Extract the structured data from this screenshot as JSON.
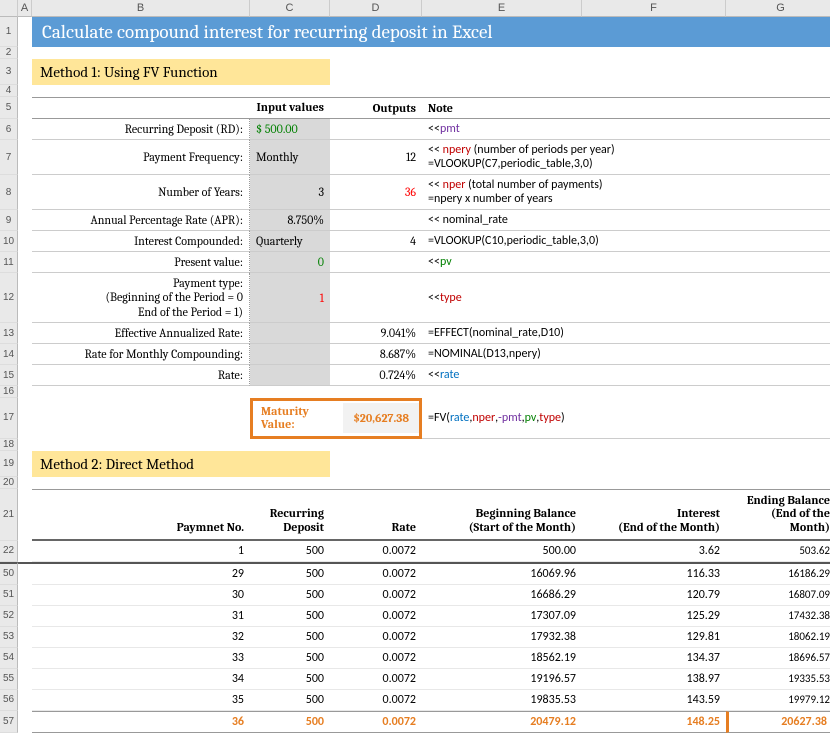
{
  "columns": [
    "A",
    "B",
    "C",
    "D",
    "E",
    "F",
    "G"
  ],
  "title": "Calculate compound interest for recurring deposit in Excel",
  "method1_title": "Method 1: Using FV Function",
  "method2_title": "Method 2: Direct Method",
  "headers": {
    "input": "Input values",
    "outputs": "Outputs",
    "note": "Note"
  },
  "rows": {
    "rd": {
      "label": "Recurring Deposit (RD):",
      "input": "$   500.00",
      "note_pre": "<< ",
      "note_kw": "pmt"
    },
    "freq": {
      "label": "Payment Frequency:",
      "input": "Monthly",
      "out": "12",
      "note_ln1a": "<< ",
      "note_ln1b": "npery",
      "note_ln1c": " (number of periods per year)",
      "note_ln2": "=VLOOKUP(C7,periodic_table,3,0)"
    },
    "yrs": {
      "label": "Number of Years:",
      "input": "3",
      "out": "36",
      "note_ln1a": "<< ",
      "note_ln1b": "nper",
      "note_ln1c": " (total number of payments)",
      "note_ln2": "=npery x number of years"
    },
    "apr": {
      "label": "Annual Percentage Rate (APR):",
      "input": "8.750%",
      "note": "<< nominal_rate"
    },
    "comp": {
      "label": "Interest Compounded:",
      "input": "Quarterly",
      "out": "4",
      "note": "=VLOOKUP(C10,periodic_table,3,0)"
    },
    "pv": {
      "label": "Present value:",
      "input": "0",
      "note_pre": "<< ",
      "note_kw": "pv"
    },
    "ptype": {
      "l1": "Payment type:",
      "l2": "(Beginning of the Period = 0",
      "l3": "End of the Period = 1)",
      "input": "1",
      "note_pre": "<< ",
      "note_kw": "type"
    },
    "ear": {
      "label": "Effective Annualized Rate:",
      "out": "9.041%",
      "note": "=EFFECT(nominal_rate,D10)"
    },
    "mrate": {
      "label": "Rate for Monthly Compounding:",
      "out": "8.687%",
      "note": "=NOMINAL(D13,npery)"
    },
    "rate": {
      "label": "Rate:",
      "out": "0.724%",
      "note_pre": "<< ",
      "note_kw": "rate"
    }
  },
  "maturity": {
    "label": "Maturity Value:",
    "value": "$20,627.38"
  },
  "fv_formula": {
    "pre": "=FV(",
    "p1": "rate",
    "p2": "nper",
    "p3": "-pmt",
    "p4": "pv",
    "p5": "type",
    "post": ")"
  },
  "table_headers": {
    "payno": "Paymnet No.",
    "rd": "Recurring Deposit",
    "rate": "Rate",
    "begin1": "Beginning Balance",
    "begin2": "(Start of the Month)",
    "int1": "Interest",
    "int2": "(End of the Month)",
    "end1": "Ending Balance",
    "end2": "(End of the Month)"
  },
  "data_rows": [
    {
      "n": "1",
      "rd": "500",
      "rate": "0.0072",
      "begin": "500.00",
      "int": "3.62",
      "end": "503.62"
    },
    {
      "n": "29",
      "rd": "500",
      "rate": "0.0072",
      "begin": "16069.96",
      "int": "116.33",
      "end": "16186.29"
    },
    {
      "n": "30",
      "rd": "500",
      "rate": "0.0072",
      "begin": "16686.29",
      "int": "120.79",
      "end": "16807.09"
    },
    {
      "n": "31",
      "rd": "500",
      "rate": "0.0072",
      "begin": "17307.09",
      "int": "125.29",
      "end": "17432.38"
    },
    {
      "n": "32",
      "rd": "500",
      "rate": "0.0072",
      "begin": "17932.38",
      "int": "129.81",
      "end": "18062.19"
    },
    {
      "n": "33",
      "rd": "500",
      "rate": "0.0072",
      "begin": "18562.19",
      "int": "134.37",
      "end": "18696.57"
    },
    {
      "n": "34",
      "rd": "500",
      "rate": "0.0072",
      "begin": "19196.57",
      "int": "138.97",
      "end": "19335.53"
    },
    {
      "n": "35",
      "rd": "500",
      "rate": "0.0072",
      "begin": "19835.53",
      "int": "143.59",
      "end": "19979.12"
    },
    {
      "n": "36",
      "rd": "500",
      "rate": "0.0072",
      "begin": "20479.12",
      "int": "148.25",
      "end": "20627.38"
    }
  ],
  "row_numbers_top": [
    "1",
    "2",
    "3",
    "4",
    "5",
    "6",
    "7",
    "8",
    "9",
    "10",
    "11",
    "12",
    "13",
    "14",
    "15",
    "16",
    "17",
    "18",
    "19",
    "20",
    "21",
    "22"
  ],
  "row_numbers_bottom": [
    "50",
    "51",
    "52",
    "53",
    "54",
    "55",
    "56",
    "57"
  ]
}
